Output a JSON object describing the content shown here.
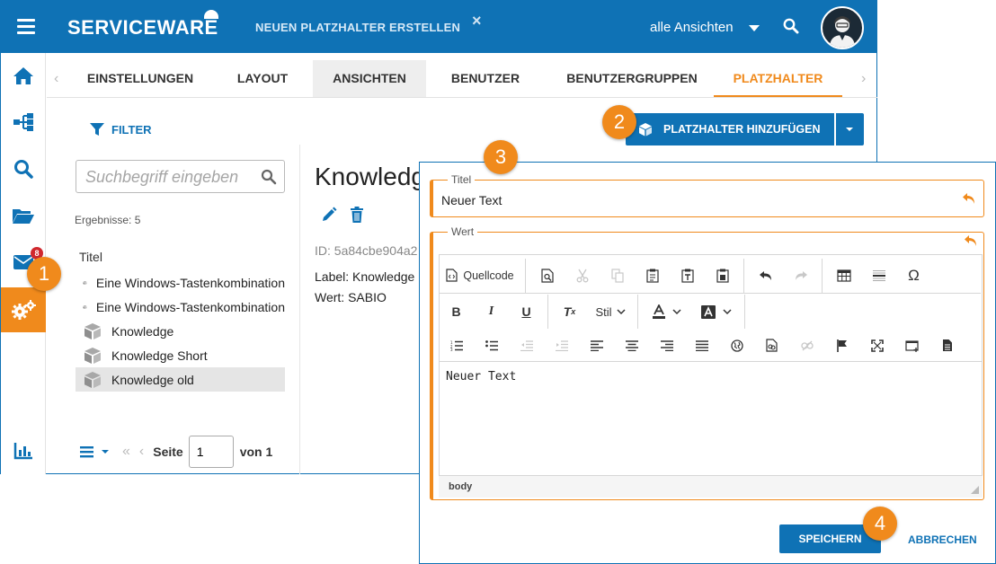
{
  "topbar": {
    "brand": "SERVICEWARE",
    "document_tab": "NEUEN PLATZHALTER ERSTELLEN",
    "views_label": "alle Ansichten"
  },
  "sidebar": {
    "items": [
      {
        "icon": "home-icon"
      },
      {
        "icon": "sitemap-icon"
      },
      {
        "icon": "search-icon"
      },
      {
        "icon": "folder-open-icon"
      },
      {
        "icon": "envelope-icon",
        "badge": "8"
      },
      {
        "icon": "cogs-icon",
        "active": true
      },
      {
        "icon": "bar-chart-icon"
      }
    ]
  },
  "tabs": [
    {
      "label": "EINSTELLUNGEN"
    },
    {
      "label": "LAYOUT"
    },
    {
      "label": "ANSICHTEN"
    },
    {
      "label": "BENUTZER"
    },
    {
      "label": "BENUTZERGRUPPEN"
    },
    {
      "label": "PLATZHALTER"
    }
  ],
  "toolbar": {
    "filter_label": "FILTER",
    "add_label": "PLATZHALTER HINZUFÜGEN"
  },
  "search": {
    "placeholder": "Suchbegriff eingeben"
  },
  "list": {
    "results_label": "Ergebnisse: 5",
    "column_header": "Titel",
    "items": [
      "Eine Windows-Tastenkombination",
      "Eine Windows-Tastenkombination",
      "Knowledge",
      "Knowledge Short",
      "Knowledge old"
    ]
  },
  "pager": {
    "page_label": "Seite",
    "page_value": "1",
    "of_label": "von 1"
  },
  "detail": {
    "title": "Knowledge",
    "id_line": "ID: 5a84cbe904a2",
    "label_line": "Label: Knowledge",
    "value_line": "Wert: SABIO"
  },
  "dialog": {
    "title_legend": "Titel",
    "title_value": "Neuer Text",
    "value_legend": "Wert",
    "source_label": "Quellcode",
    "style_label": "Stil",
    "editor_content": "Neuer Text",
    "status_path": "body",
    "save_label": "SPEICHERN",
    "cancel_label": "ABBRECHEN"
  },
  "callouts": [
    "1",
    "2",
    "3",
    "4"
  ],
  "colors": {
    "primary": "#0f72b5",
    "accent": "#f08a1c",
    "badge": "#d0282e"
  }
}
